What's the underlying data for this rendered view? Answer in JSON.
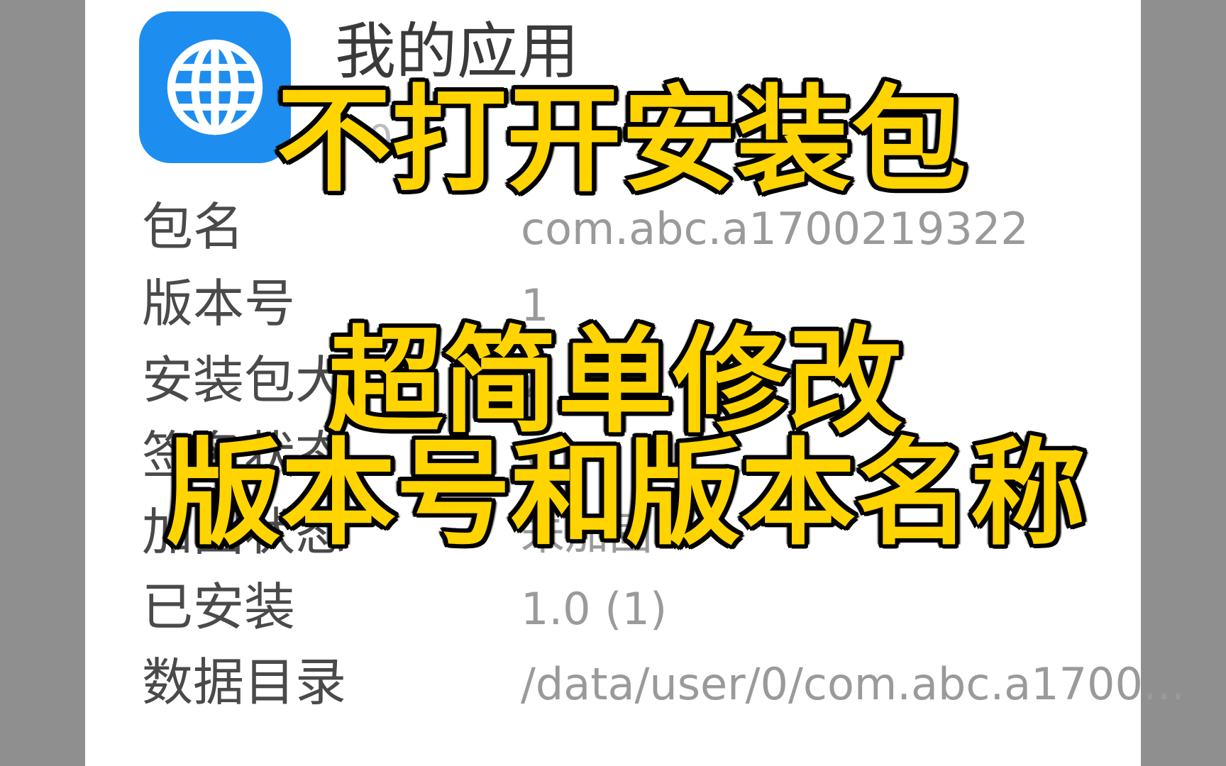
{
  "app": {
    "title": "我的应用",
    "subtitle_partial": "0"
  },
  "details": [
    {
      "label": "包名",
      "value": "com.abc.a1700219322"
    },
    {
      "label": "版本号",
      "value": "1"
    },
    {
      "label": "安装包大",
      "value": "2"
    },
    {
      "label": "签名状态",
      "value": "V1"
    },
    {
      "label": "加固状态",
      "value": "未加固"
    },
    {
      "label": "已安装",
      "value": "1.0 (1)"
    },
    {
      "label": "数据目录",
      "value": "/data/user/0/com.abc.a1700..."
    }
  ],
  "overlay": {
    "line1": "不打开安装包",
    "line2": "超简单修改",
    "line3": "版本号和版本名称"
  },
  "colors": {
    "icon_bg": "#1e8df0",
    "overlay_text": "#ffd400",
    "overlay_outline": "#000000"
  },
  "icons": {
    "app_icon": "globe-icon"
  }
}
